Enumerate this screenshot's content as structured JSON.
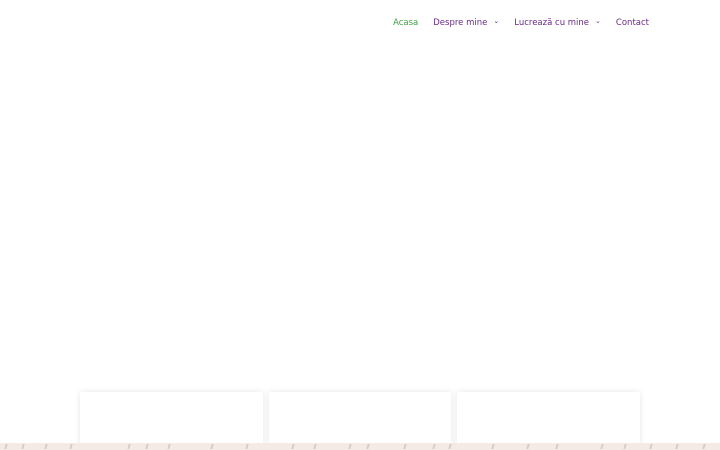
{
  "nav": {
    "items": [
      {
        "label": "Acasa",
        "active": true,
        "has_dropdown": false
      },
      {
        "label": "Despre mine",
        "active": false,
        "has_dropdown": true
      },
      {
        "label": "Lucrează cu mine",
        "active": false,
        "has_dropdown": true
      },
      {
        "label": "Contact",
        "active": false,
        "has_dropdown": false
      }
    ]
  },
  "colors": {
    "nav_text": "#6a2a86",
    "nav_active": "#3f9e44",
    "footer_band": "#f4ebe6"
  },
  "icons": {
    "dropdown": "chevron-down-icon"
  }
}
